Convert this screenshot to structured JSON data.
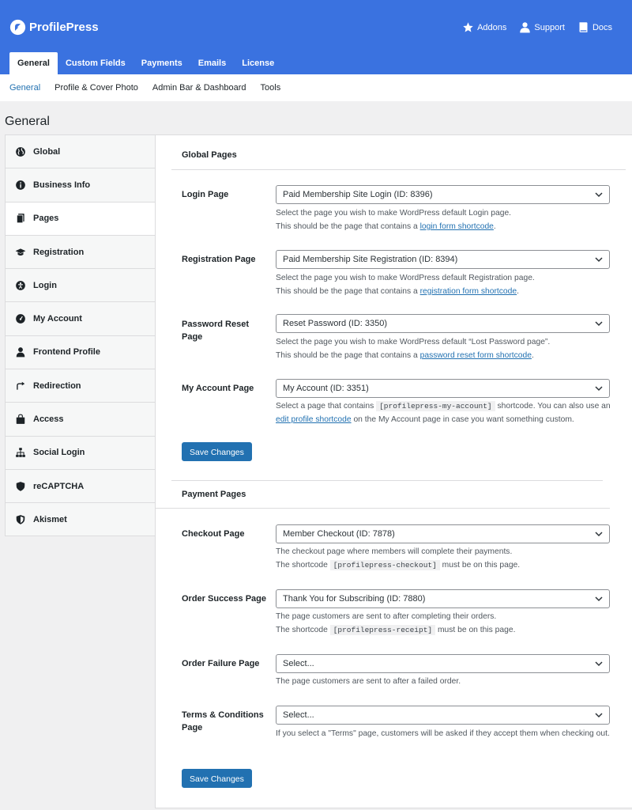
{
  "brand": {
    "name": "ProfilePress"
  },
  "header_links": [
    {
      "label": "Addons",
      "icon": "star-icon"
    },
    {
      "label": "Support",
      "icon": "user-icon"
    },
    {
      "label": "Docs",
      "icon": "book-icon"
    }
  ],
  "main_tabs": [
    "General",
    "Custom Fields",
    "Payments",
    "Emails",
    "License"
  ],
  "sub_tabs": [
    "General",
    "Profile & Cover Photo",
    "Admin Bar & Dashboard",
    "Tools"
  ],
  "page_title": "General",
  "sidebar": [
    {
      "label": "Global",
      "icon": "globe-icon"
    },
    {
      "label": "Business Info",
      "icon": "info-icon"
    },
    {
      "label": "Pages",
      "icon": "pages-icon"
    },
    {
      "label": "Registration",
      "icon": "graduation-cap-icon"
    },
    {
      "label": "Login",
      "icon": "universal-access-icon"
    },
    {
      "label": "My Account",
      "icon": "dashboard-icon"
    },
    {
      "label": "Frontend Profile",
      "icon": "user-icon"
    },
    {
      "label": "Redirection",
      "icon": "redirect-icon"
    },
    {
      "label": "Access",
      "icon": "shopping-bag-icon"
    },
    {
      "label": "Social Login",
      "icon": "sitemap-icon"
    },
    {
      "label": "reCAPTCHA",
      "icon": "shield-icon"
    },
    {
      "label": "Akismet",
      "icon": "shield-half-icon"
    }
  ],
  "global_pages": {
    "title": "Global Pages",
    "login": {
      "label": "Login Page",
      "value": "Paid Membership Site Login (ID: 8396)",
      "desc1": "Select the page you wish to make WordPress default Login page.",
      "desc2_pre": "This should be the page that contains a ",
      "desc2_link": "login form shortcode",
      "desc2_post": "."
    },
    "registration": {
      "label": "Registration Page",
      "value": "Paid Membership Site Registration (ID: 8394)",
      "desc1": "Select the page you wish to make WordPress default Registration page.",
      "desc2_pre": "This should be the page that contains a ",
      "desc2_link": "registration form shortcode",
      "desc2_post": "."
    },
    "password_reset": {
      "label": "Password Reset Page",
      "value": "Reset Password (ID: 3350)",
      "desc1": "Select the page you wish to make WordPress default “Lost Password page”.",
      "desc2_pre": "This should be the page that contains a ",
      "desc2_link": "password reset form shortcode",
      "desc2_post": "."
    },
    "my_account": {
      "label": "My Account Page",
      "value": "My Account (ID: 3351)",
      "desc_pre": "Select a page that contains ",
      "desc_code": "[profilepress-my-account]",
      "desc_mid": " shortcode. You can also use an ",
      "desc_link": "edit profile shortcode",
      "desc_post": " on the My Account page in case you want something custom."
    },
    "save": "Save Changes"
  },
  "payment_pages": {
    "title": "Payment Pages",
    "checkout": {
      "label": "Checkout Page",
      "value": "Member Checkout (ID: 7878)",
      "desc1": "The checkout page where members will complete their payments.",
      "desc2_pre": "The shortcode ",
      "desc2_code": "[profilepress-checkout]",
      "desc2_post": " must be on this page."
    },
    "order_success": {
      "label": "Order Success Page",
      "value": "Thank You for Subscribing (ID: 7880)",
      "desc1": "The page customers are sent to after completing their orders.",
      "desc2_pre": "The shortcode ",
      "desc2_code": "[profilepress-receipt]",
      "desc2_post": " must be on this page."
    },
    "order_failure": {
      "label": "Order Failure Page",
      "value": "Select...",
      "desc1": "The page customers are sent to after a failed order."
    },
    "terms": {
      "label": "Terms & Conditions Page",
      "value": "Select...",
      "desc1": "If you select a \"Terms\" page, customers will be asked if they accept them when checking out."
    },
    "save": "Save Changes"
  },
  "colors": {
    "header": "#3a72e0",
    "primary_button": "#2271b1",
    "link": "#2271b1"
  }
}
